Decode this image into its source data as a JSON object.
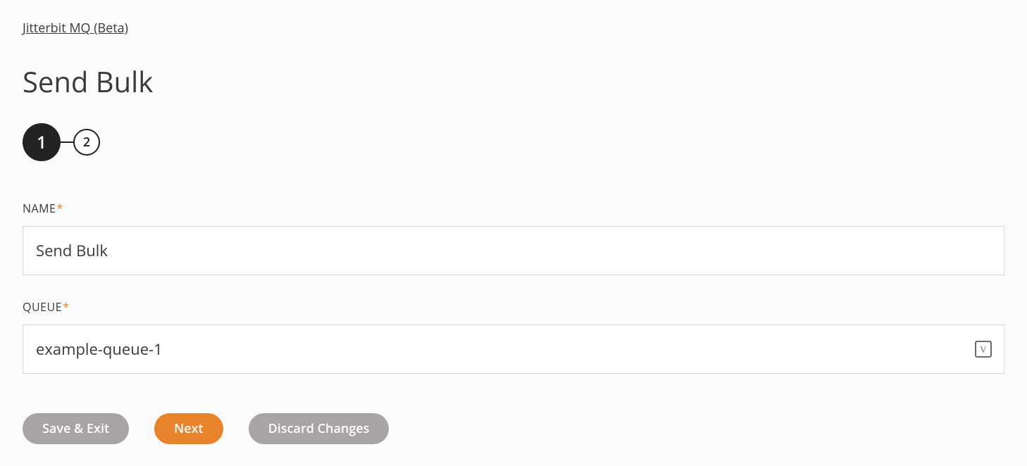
{
  "breadcrumb": "Jitterbit MQ (Beta)",
  "page_title": "Send Bulk",
  "stepper": {
    "step1": "1",
    "step2": "2"
  },
  "form": {
    "name_label": "NAME",
    "name_value": "Send Bulk",
    "queue_label": "QUEUE",
    "queue_value": "example-queue-1",
    "variable_icon_label": "V"
  },
  "buttons": {
    "save_exit": "Save & Exit",
    "next": "Next",
    "discard": "Discard Changes"
  }
}
